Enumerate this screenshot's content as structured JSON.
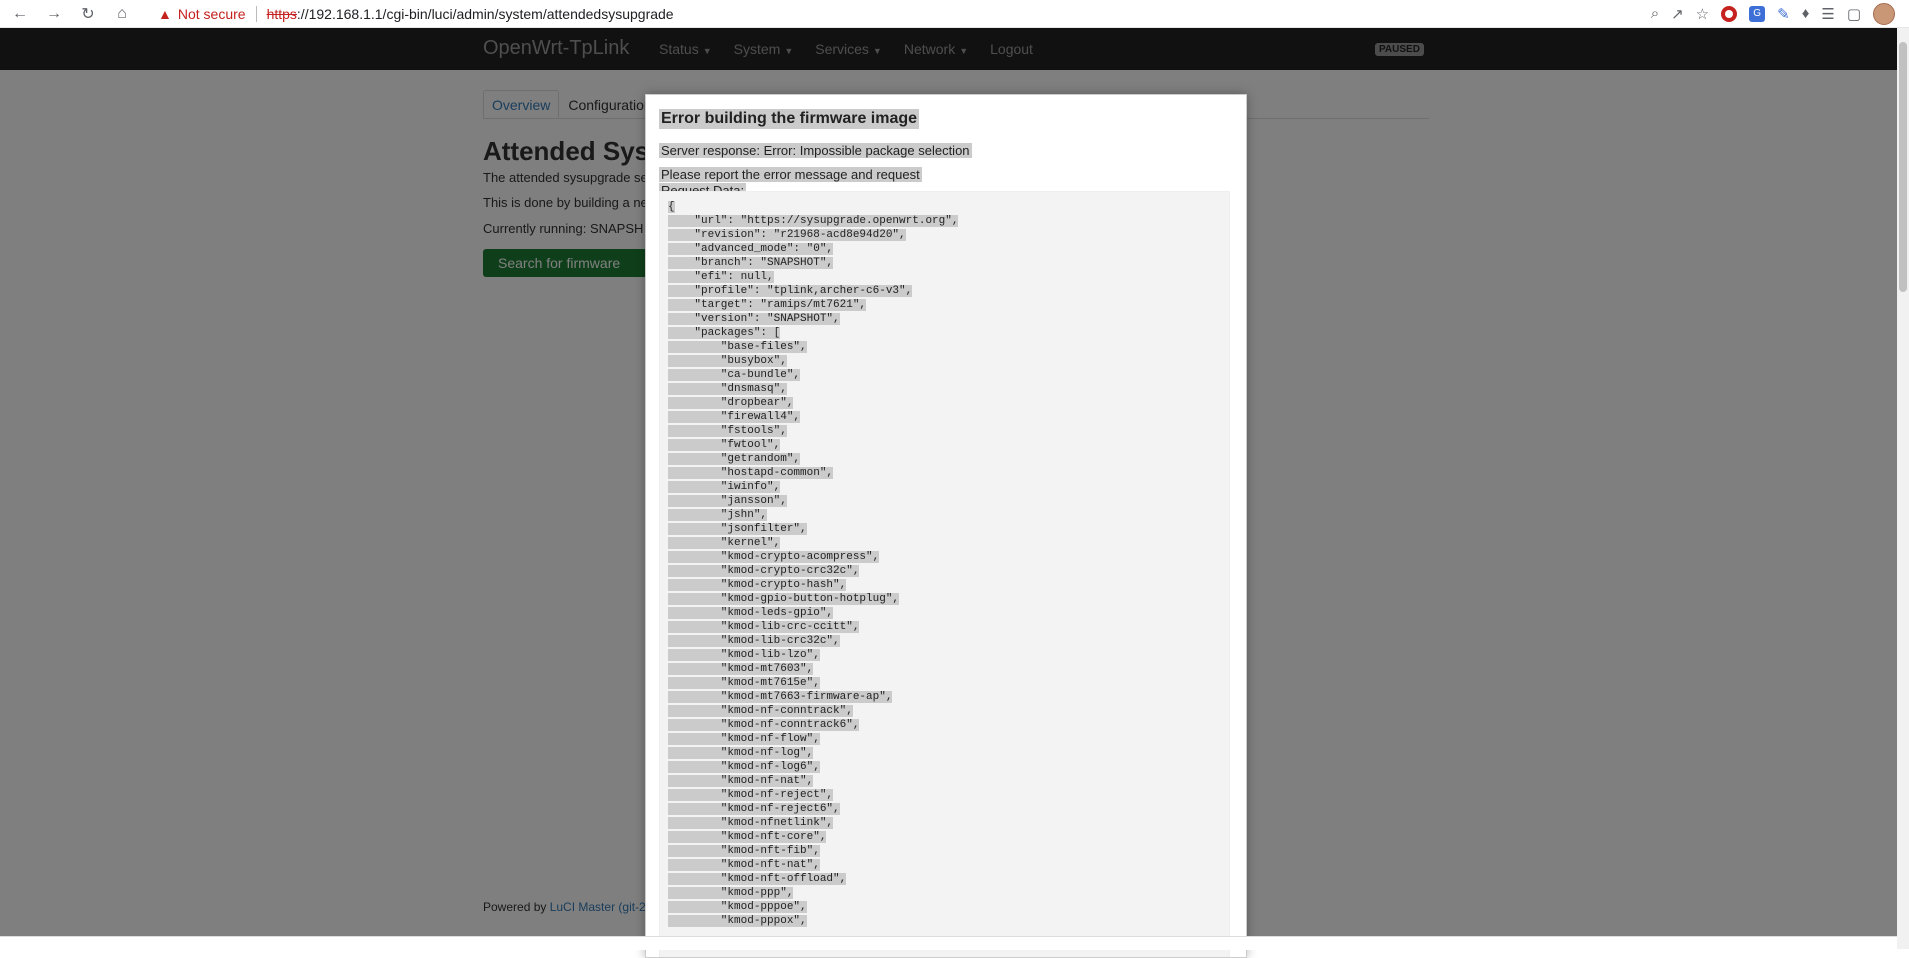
{
  "browser": {
    "security_label": "Not secure",
    "url_protocol": "https",
    "url_rest": "://192.168.1.1/cgi-bin/luci/admin/system/attendedsysupgrade",
    "back_icon": "back-arrow-icon",
    "forward_icon": "forward-arrow-icon",
    "reload_icon": "reload-icon",
    "home_icon": "home-icon"
  },
  "header": {
    "brand": "OpenWrt-TpLink",
    "menu": [
      "Status",
      "System",
      "Services",
      "Network"
    ],
    "logout": "Logout",
    "paused_badge": "PAUSED"
  },
  "main": {
    "tabs": [
      "Overview",
      "Configuration"
    ],
    "title": "Attended Sysu",
    "desc1": "The attended sysupgrade se",
    "desc2": "This is done by building a ne",
    "desc3": "Currently running: SNAPSH",
    "search_button": "Search for firmware upgra",
    "footer_prefix": "Powered by ",
    "footer_link": "LuCI Master (git-2"
  },
  "modal": {
    "title": "Error building the firmware image",
    "server_response": "Server response: Error: Impossible package selection",
    "report_line": "Please report the error message and request",
    "request_data_label": "Request Data:",
    "code_lines": [
      "{",
      "    \"url\": \"https://sysupgrade.openwrt.org\",",
      "    \"revision\": \"r21968-acd8e94d20\",",
      "    \"advanced_mode\": \"0\",",
      "    \"branch\": \"SNAPSHOT\",",
      "    \"efi\": null,",
      "    \"profile\": \"tplink,archer-c6-v3\",",
      "    \"target\": \"ramips/mt7621\",",
      "    \"version\": \"SNAPSHOT\",",
      "    \"packages\": [",
      "        \"base-files\",",
      "        \"busybox\",",
      "        \"ca-bundle\",",
      "        \"dnsmasq\",",
      "        \"dropbear\",",
      "        \"firewall4\",",
      "        \"fstools\",",
      "        \"fwtool\",",
      "        \"getrandom\",",
      "        \"hostapd-common\",",
      "        \"iwinfo\",",
      "        \"jansson\",",
      "        \"jshn\",",
      "        \"jsonfilter\",",
      "        \"kernel\",",
      "        \"kmod-crypto-acompress\",",
      "        \"kmod-crypto-crc32c\",",
      "        \"kmod-crypto-hash\",",
      "        \"kmod-gpio-button-hotplug\",",
      "        \"kmod-leds-gpio\",",
      "        \"kmod-lib-crc-ccitt\",",
      "        \"kmod-lib-crc32c\",",
      "        \"kmod-lib-lzo\",",
      "        \"kmod-mt7603\",",
      "        \"kmod-mt7615e\",",
      "        \"kmod-mt7663-firmware-ap\",",
      "        \"kmod-nf-conntrack\",",
      "        \"kmod-nf-conntrack6\",",
      "        \"kmod-nf-flow\",",
      "        \"kmod-nf-log\",",
      "        \"kmod-nf-log6\",",
      "        \"kmod-nf-nat\",",
      "        \"kmod-nf-reject\",",
      "        \"kmod-nf-reject6\",",
      "        \"kmod-nfnetlink\",",
      "        \"kmod-nft-core\",",
      "        \"kmod-nft-fib\",",
      "        \"kmod-nft-nat\",",
      "        \"kmod-nft-offload\",",
      "        \"kmod-ppp\",",
      "        \"kmod-pppoe\",",
      "        \"kmod-pppox\","
    ]
  }
}
